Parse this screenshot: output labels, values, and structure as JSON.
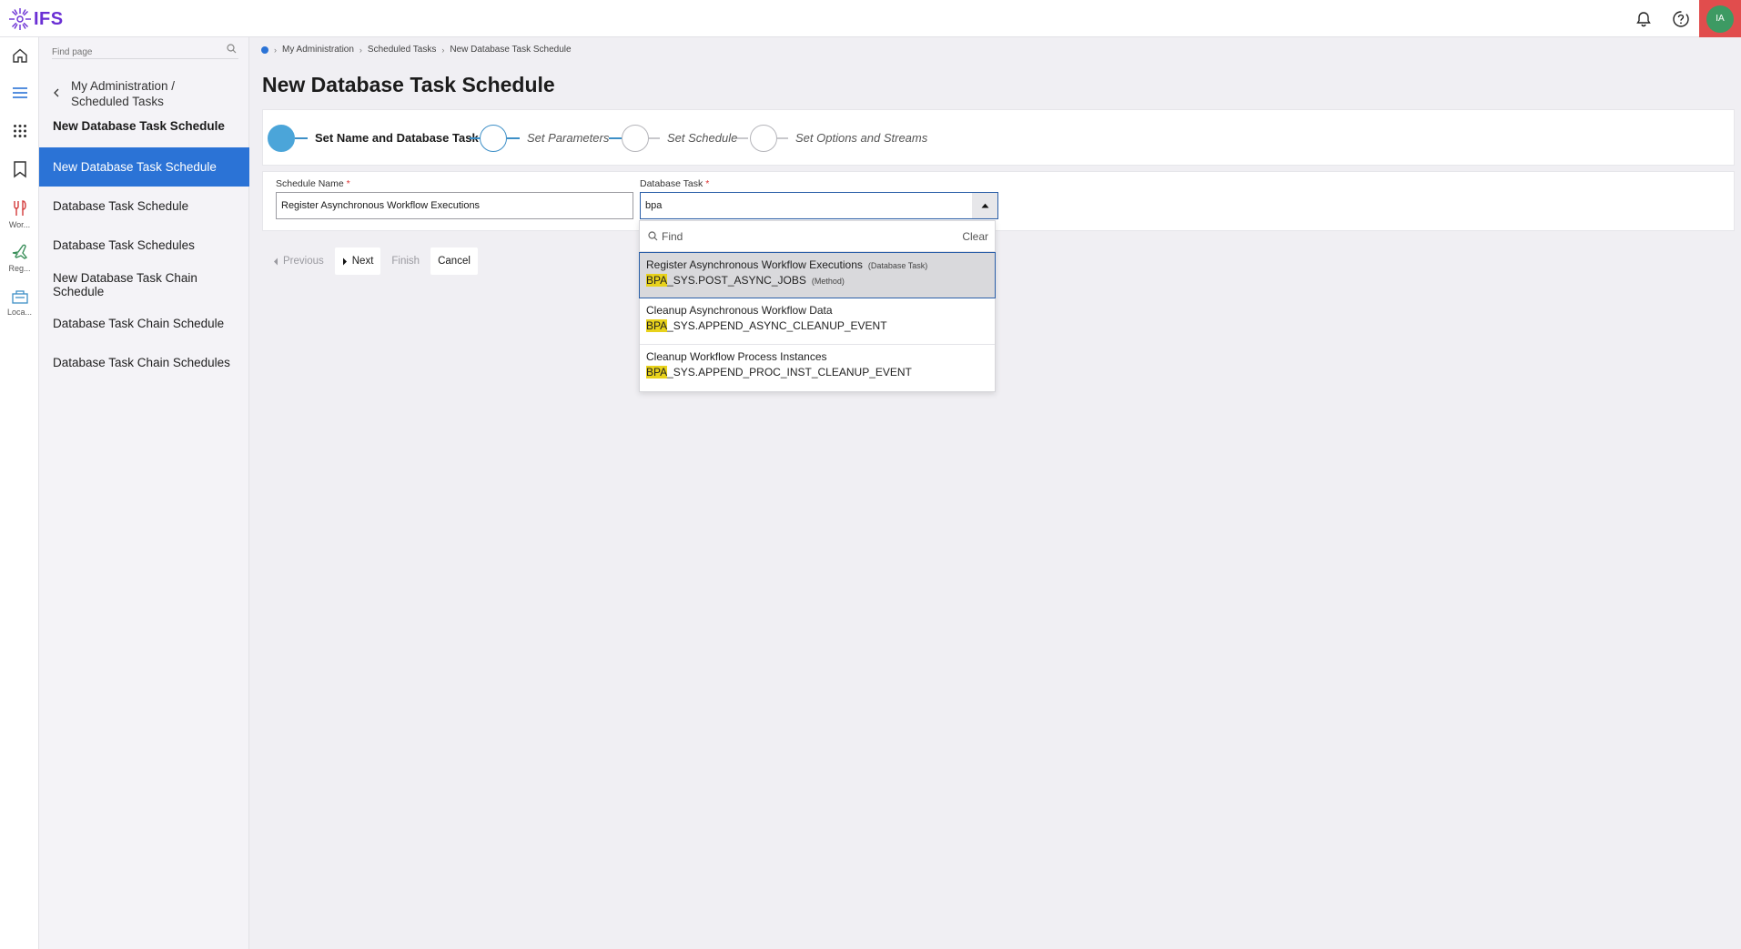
{
  "app": {
    "logo_text": "IFS",
    "avatar_initials": "IA",
    "colors": {
      "accent": "#2b73d6",
      "brand": "#6a2fd4",
      "avatar_bg": "#3d9a63",
      "avatar_frame": "#e14d4d",
      "highlight": "#e8d21b"
    }
  },
  "rail": {
    "items": [
      {
        "icon": "home-icon"
      },
      {
        "icon": "menu-icon"
      },
      {
        "icon": "apps-grid-icon"
      },
      {
        "icon": "bookmark-icon"
      },
      {
        "icon": "tools-icon",
        "label": "Wor..."
      },
      {
        "icon": "plane-icon",
        "label": "Reg..."
      },
      {
        "icon": "location-icon",
        "label": "Loca..."
      }
    ]
  },
  "nav": {
    "search_placeholder": "Find page",
    "back_label_1": "My Administration /",
    "back_label_2": "Scheduled Tasks",
    "title": "New Database Task Schedule",
    "items": [
      {
        "label": "New Database Task Schedule",
        "active": true
      },
      {
        "label": "Database Task Schedule"
      },
      {
        "label": "Database Task Schedules"
      },
      {
        "label": "New Database Task Chain Schedule"
      },
      {
        "label": "Database Task Chain Schedule"
      },
      {
        "label": "Database Task Chain Schedules"
      }
    ]
  },
  "breadcrumb": [
    "My Administration",
    "Scheduled Tasks",
    "New Database Task Schedule"
  ],
  "page": {
    "title": "New Database Task Schedule"
  },
  "stepper": {
    "steps": [
      {
        "label": "Set Name and Database Task",
        "state": "current"
      },
      {
        "label": "Set Parameters",
        "state": "next"
      },
      {
        "label": "Set Schedule",
        "state": "pending"
      },
      {
        "label": "Set Options and Streams",
        "state": "pending"
      }
    ]
  },
  "form": {
    "schedule_name_label": "Schedule Name",
    "schedule_name_value": "Register Asynchronous Workflow Executions",
    "database_task_label": "Database Task",
    "database_task_value": "bpa",
    "required_mark": "*"
  },
  "wizard_buttons": {
    "previous": "Previous",
    "next": "Next",
    "finish": "Finish",
    "cancel": "Cancel"
  },
  "dropdown": {
    "find_placeholder": "Find",
    "clear_label": "Clear",
    "options": [
      {
        "title": "Register Asynchronous Workflow Executions",
        "title_tag": "(Database Task)",
        "match": "BPA",
        "rest": "_SYS.POST_ASYNC_JOBS",
        "code_tag": "(Method)",
        "selected": true
      },
      {
        "title": "Cleanup Asynchronous Workflow Data",
        "title_tag": "",
        "match": "BPA",
        "rest": "_SYS.APPEND_ASYNC_CLEANUP_EVENT",
        "code_tag": ""
      },
      {
        "title": "Cleanup Workflow Process Instances",
        "title_tag": "",
        "match": "BPA",
        "rest": "_SYS.APPEND_PROC_INST_CLEANUP_EVENT",
        "code_tag": ""
      }
    ]
  }
}
